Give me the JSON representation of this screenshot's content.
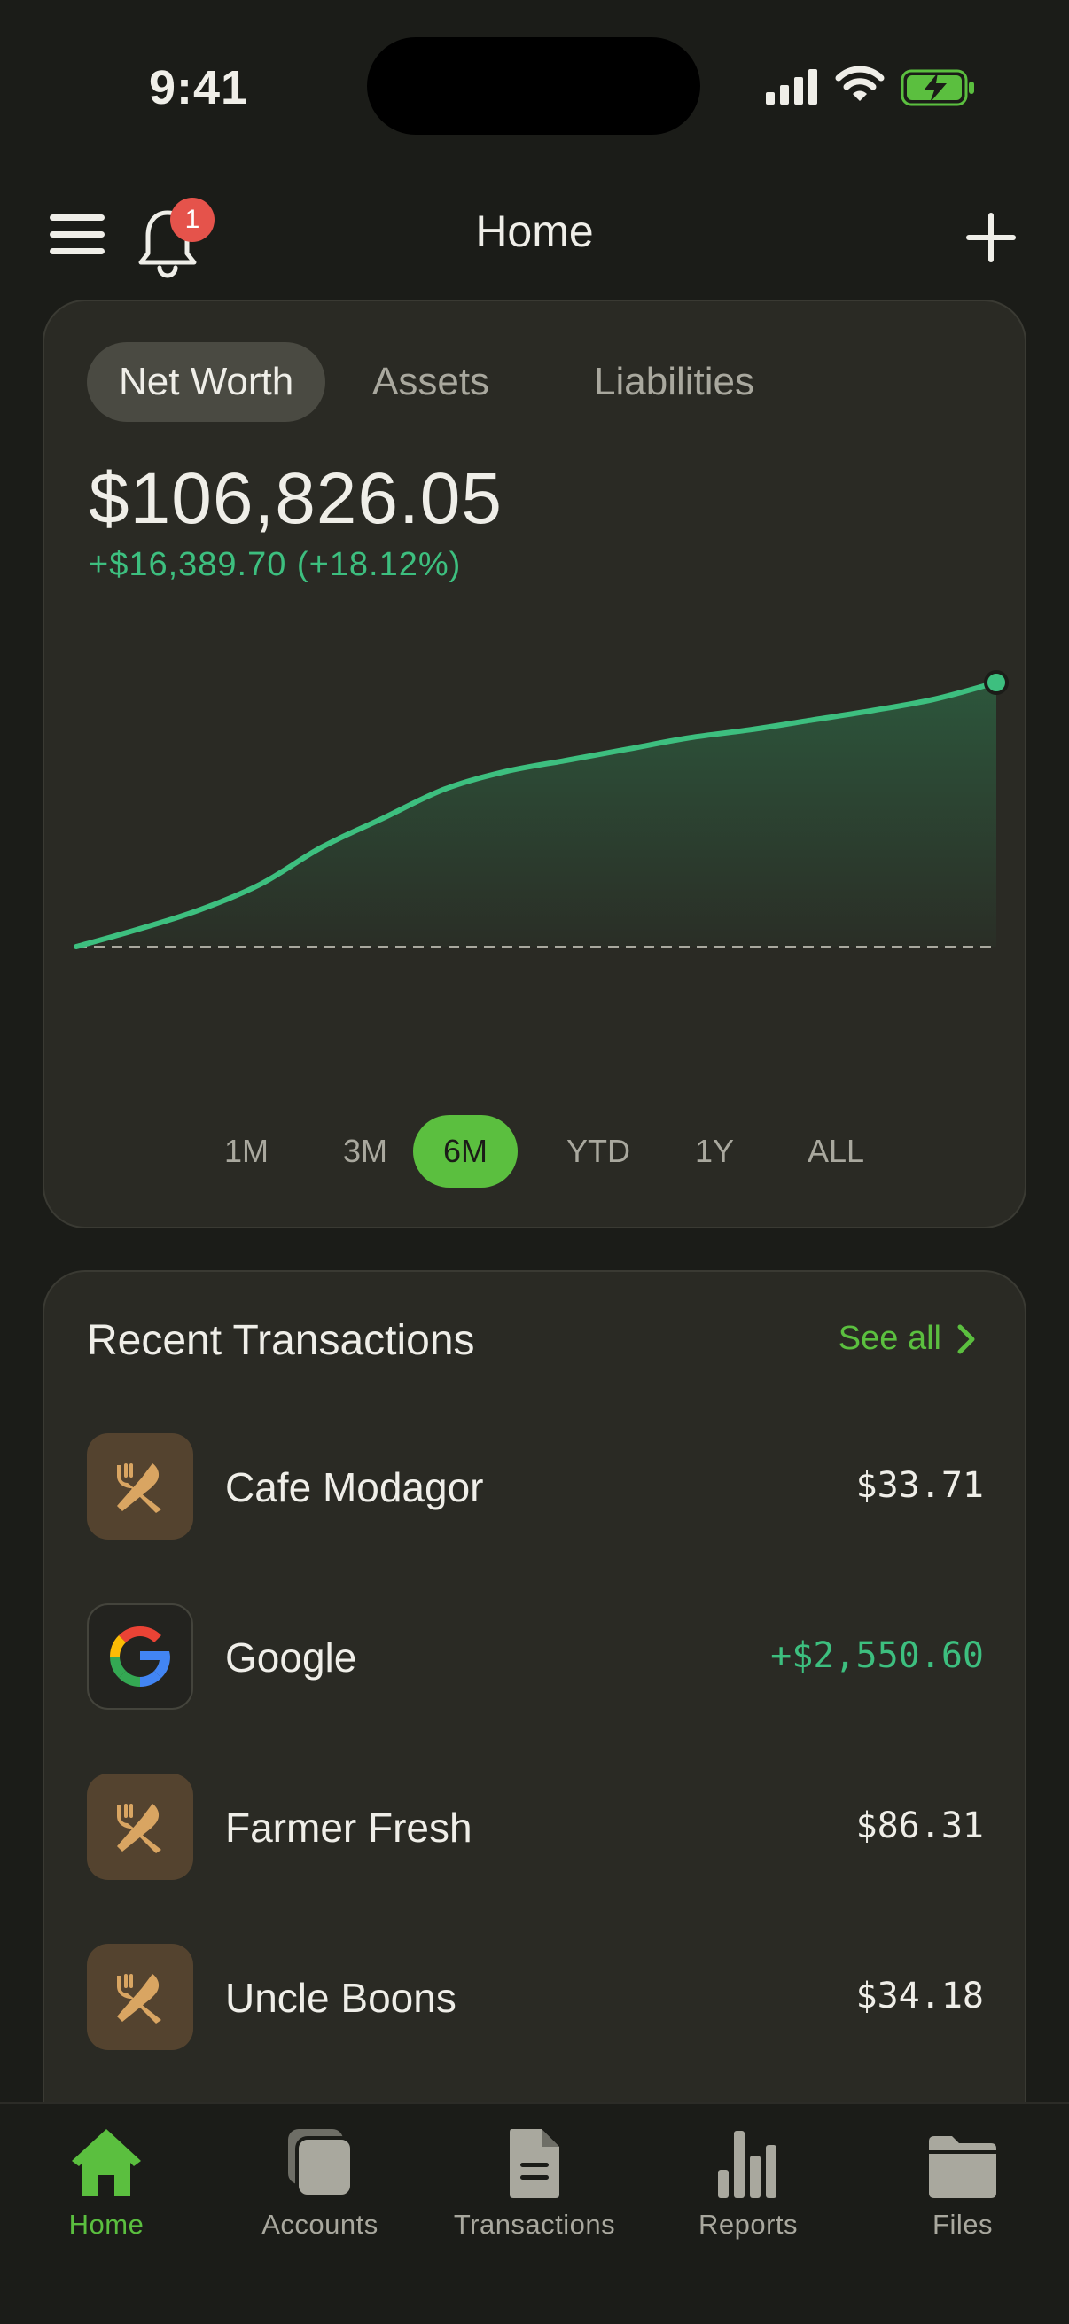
{
  "status_bar": {
    "time": "9:41"
  },
  "header": {
    "title": "Home",
    "notification_count": "1",
    "icons": [
      "menu-icon",
      "bell-icon",
      "plus-icon"
    ]
  },
  "net_worth": {
    "tabs": [
      {
        "label": "Net Worth",
        "active": true
      },
      {
        "label": "Assets",
        "active": false
      },
      {
        "label": "Liabilities",
        "active": false
      }
    ],
    "amount": "$106,826.05",
    "change": "+$16,389.70 (+18.12%)",
    "ranges": [
      {
        "label": "1M",
        "active": false
      },
      {
        "label": "3M",
        "active": false
      },
      {
        "label": "6M",
        "active": true
      },
      {
        "label": "YTD",
        "active": false
      },
      {
        "label": "1Y",
        "active": false
      },
      {
        "label": "ALL",
        "active": false
      }
    ]
  },
  "chart_data": {
    "type": "area",
    "title": "",
    "xlabel": "",
    "ylabel": "",
    "grid": false,
    "series": [
      {
        "values": [
          90437,
          91500,
          92700,
          94300,
          96600,
          98400,
          100200,
          101300,
          102000,
          102700,
          103400,
          103900,
          104500,
          105100,
          105800,
          106826
        ]
      }
    ],
    "baseline": 90437,
    "ylim": [
      90437,
      106826.05
    ],
    "colors": {
      "line": "#3dbf7f",
      "baseline": "#a9a89e"
    }
  },
  "transactions": {
    "title": "Recent Transactions",
    "see_all_label": "See all",
    "items": [
      {
        "name": "Cafe Modagor",
        "amount": "$33.71",
        "icon": "fork-knife-icon",
        "positive": false
      },
      {
        "name": "Google",
        "amount": "+$2,550.60",
        "icon": "google-logo-icon",
        "positive": true
      },
      {
        "name": "Farmer Fresh",
        "amount": "$86.31",
        "icon": "fork-knife-icon",
        "positive": false
      },
      {
        "name": "Uncle Boons",
        "amount": "$34.18",
        "icon": "fork-knife-icon",
        "positive": false
      }
    ]
  },
  "tab_bar": {
    "items": [
      {
        "label": "Home",
        "icon": "home-icon",
        "active": true
      },
      {
        "label": "Accounts",
        "icon": "accounts-icon",
        "active": false
      },
      {
        "label": "Transactions",
        "icon": "transactions-icon",
        "active": false
      },
      {
        "label": "Reports",
        "icon": "reports-icon",
        "active": false
      },
      {
        "label": "Files",
        "icon": "files-icon",
        "active": false
      }
    ]
  },
  "colors": {
    "background": "#1b1c18",
    "card": "#2a2a24",
    "accent_green": "#5bbf3f",
    "positive_green": "#3dbf7f",
    "badge_red": "#e5534b",
    "food_icon": "#d9a562"
  }
}
